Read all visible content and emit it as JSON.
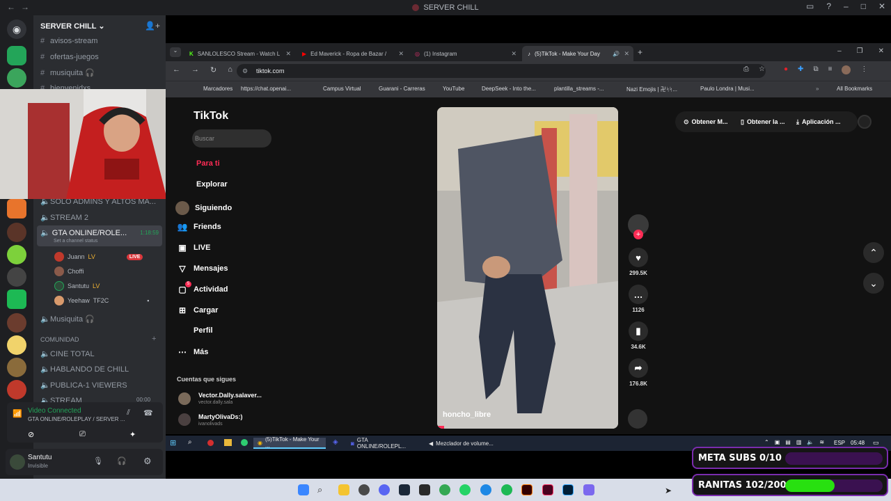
{
  "titlebar": {
    "title": "SERVER CHILL"
  },
  "server": {
    "name": "SERVER CHILL"
  },
  "channels": {
    "top": [
      "avisos-stream",
      "ofertas-juegos",
      "musiquita 🎧",
      "bienvenidxs"
    ],
    "voice": [
      "SOLO ADMINS Y ALTOS MA...",
      "STREAM 2"
    ],
    "active_voice": {
      "name": "GTA ONLINE/ROLE...",
      "timer": "1:18:59",
      "status": "Set a channel status"
    },
    "users": [
      {
        "name": "Juann",
        "tag": "LV",
        "badge": "LIVE"
      },
      {
        "name": "Choffi",
        "tag": ""
      },
      {
        "name": "Santutu",
        "tag": "LV"
      },
      {
        "name": "Yeehaw",
        "tag": "TF2C"
      }
    ],
    "after": "Musiquita 🎧",
    "category": "COMUNIDAD",
    "community": [
      "CINE TOTAL",
      "HABLANDO DE CHILL",
      "PUBLICA-1 VIEWERS",
      "STREAM"
    ],
    "stream_time": "00:00"
  },
  "voice_panel": {
    "status": "Video Connected",
    "channel": "GTA ONLINE/ROLEPLAY / SERVER ..."
  },
  "user_panel": {
    "name": "Santutu",
    "status": "Invisible"
  },
  "browser": {
    "tabs": [
      {
        "label": "SANLOLESCO Stream - Watch L"
      },
      {
        "label": "Ed Maverick - Ropa de Bazar /"
      },
      {
        "label": "(1) Instagram"
      },
      {
        "label": "(5)TikTok - Make Your Day"
      }
    ],
    "url": "tiktok.com",
    "bookmarks": [
      "Marcadores",
      "https://chat.openai...",
      "Campus Virtual",
      "Guarani - Carreras",
      "YouTube",
      "DeepSeek - Into the...",
      "plantilla_streams -...",
      "Nazi Emojis | 卍ᛋᛋ...",
      "Paulo Londra | Musi..."
    ],
    "all_bookmarks": "All Bookmarks"
  },
  "tiktok": {
    "logo": "TikTok",
    "search_placeholder": "Buscar",
    "nav": [
      "Para ti",
      "Explorar",
      "Siguiendo",
      "Friends",
      "LIVE",
      "Mensajes",
      "Actividad",
      "Cargar",
      "Perfil",
      "Más"
    ],
    "activity_badge": "5",
    "following_title": "Cuentas que sigues",
    "following": [
      {
        "name": "Vector.Dally.salaver...",
        "handle": "vector.dally.sala"
      },
      {
        "name": "MartyOlivaDs:)",
        "handle": "ivanolivads"
      }
    ],
    "top_buttons": [
      "Obtener M...",
      "Obtener la ...",
      "Aplicación ..."
    ],
    "video_user": "honcho_libre",
    "likes": "299.5K",
    "comments": "1126",
    "saves": "34.6K",
    "shares": "176.8K"
  },
  "taskbar": {
    "apps": [
      "(5)TikTok - Make Your ...",
      "GTA ONLINE/ROLEPL...",
      "Mezclador de volume..."
    ],
    "lang": "ESP",
    "time": "05:48"
  },
  "overlays": {
    "subs_label": "META SUBS 0/10",
    "subs_progress": 0.0,
    "ranitas_label": "RANITAS 102/200",
    "ranitas_progress": 0.51
  }
}
